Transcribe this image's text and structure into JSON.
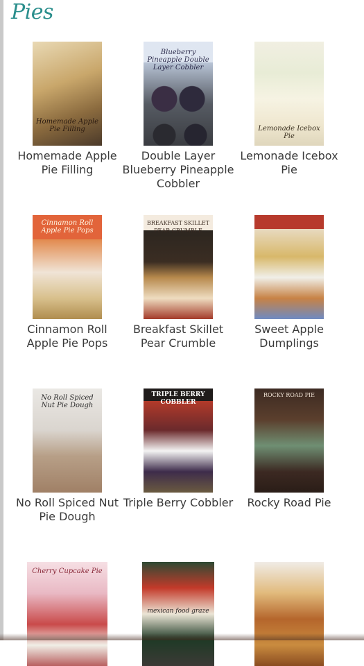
{
  "section": {
    "title": "Pies"
  },
  "recipes": [
    {
      "label": "Homemade Apple Pie Filling",
      "image_text": "Homemade Apple Pie Filling",
      "image_alt": "apple pie filling photo"
    },
    {
      "label": "Double Layer Blueberry Pineapple Cobbler",
      "image_text": "Blueberry Pineapple Double Layer Cobbler",
      "image_alt": "blueberry cobbler photo"
    },
    {
      "label": "Lemonade Icebox Pie",
      "image_text": "Lemonade Icebox Pie",
      "image_alt": "lemonade icebox pie photo"
    },
    {
      "label": "Cinnamon Roll Apple Pie Pops",
      "image_text": "Cinnamon Roll Apple Pie Pops",
      "image_alt": "cinnamon roll apple pie pops photo"
    },
    {
      "label": "Breakfast Skillet Pear Crumble",
      "image_text": "BREAKFAST SKILLET PEAR CRUMBLE",
      "image_alt": "pear crumble photo"
    },
    {
      "label": "Sweet Apple Dumplings",
      "image_text": "",
      "image_alt": "apple dumplings collage"
    },
    {
      "label": "No Roll Spiced Nut Pie Dough",
      "image_text": "No Roll Spiced Nut Pie Dough",
      "image_alt": "pie dough photo"
    },
    {
      "label": "Triple Berry Cobbler",
      "image_text": "TRIPLE BERRY COBBLER",
      "image_alt": "triple berry cobbler photo"
    },
    {
      "label": "Rocky Road Pie",
      "image_text": "ROCKY ROAD PIE",
      "image_alt": "rocky road pie photo"
    },
    {
      "label": "",
      "image_text": "Cherry Cupcake Pie",
      "image_alt": "cherry cupcake pie collage"
    },
    {
      "label": "",
      "image_text": "mexican food graze",
      "image_alt": "mexican food spread photo"
    },
    {
      "label": "",
      "image_text": "",
      "image_alt": "lattice pie bars photo"
    }
  ]
}
